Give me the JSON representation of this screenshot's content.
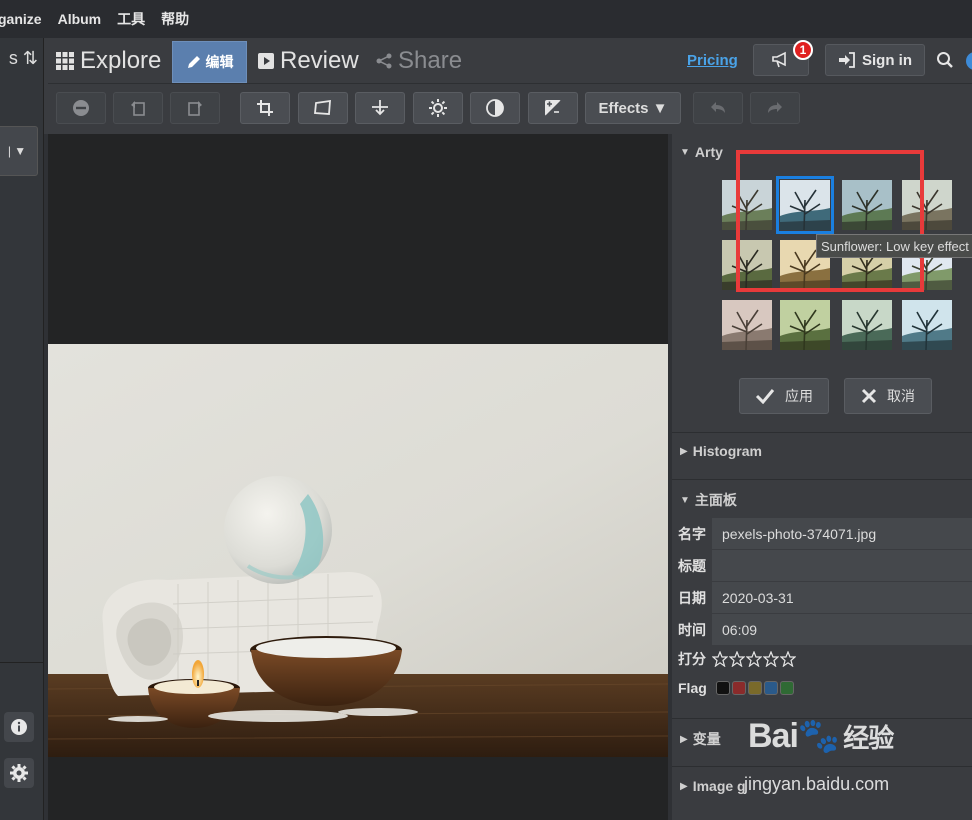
{
  "menubar": {
    "items": [
      "ganize",
      "Album",
      "工具",
      "帮助"
    ]
  },
  "nav": {
    "explore": "Explore",
    "edit": "编辑",
    "review": "Review",
    "share": "Share",
    "pricing": "Pricing",
    "notification_count": "1",
    "sign_in": "Sign in"
  },
  "toolbar": {
    "effects_label": "Effects ▼"
  },
  "arty": {
    "title": "Arty",
    "tooltip": "Sunflower: Low key effect",
    "apply": "应用",
    "cancel": "取消"
  },
  "histogram": {
    "title": "Histogram"
  },
  "main_panel": {
    "title": "主面板",
    "name_label": "名字",
    "name_value": "pexels-photo-374071.jpg",
    "title_label": "标题",
    "title_value": "",
    "date_label": "日期",
    "date_value": "2020-03-31",
    "time_label": "时间",
    "time_value": "06:09",
    "rating_label": "打分",
    "rating_value": 0,
    "rating_max": 5,
    "flag_label": "Flag"
  },
  "variables": {
    "title": "变量"
  },
  "image_gallery": {
    "title": "Image g"
  },
  "watermark": {
    "logo": "Bai",
    "logo_zh": "经验",
    "url": "jingyan.baidu.com"
  },
  "colors": {
    "accent": "#5b7fae",
    "highlight_box": "#e83a3a",
    "selected_thumb": "#1a7fe0",
    "pricing_link": "#4aa3e8",
    "badge": "#e02020",
    "flag_colors": [
      "#111111",
      "#8a2b2b",
      "#7a6a2a",
      "#2a5a8a",
      "#2f6a34"
    ]
  }
}
